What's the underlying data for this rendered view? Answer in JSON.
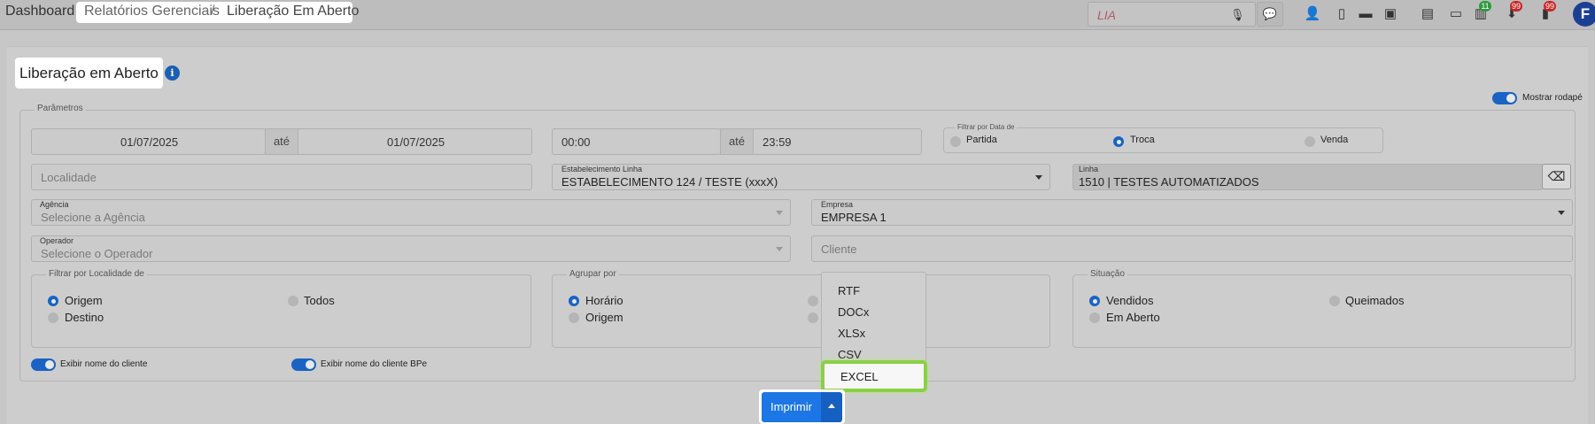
{
  "breadcrumb": {
    "home": "Dashboard",
    "level1": "Relatórios Gerenciais",
    "sep": "/",
    "current": "Liberação Em Aberto"
  },
  "topbar": {
    "search_placeholder": "LIA",
    "icons": [
      "user-key-icon",
      "mobile-icon",
      "ticket-icon",
      "save-icon",
      "newspaper-icon",
      "monitor-icon",
      "cash-icon",
      "download-icon",
      "document-icon"
    ],
    "badges": {
      "cash": "11",
      "download": "99",
      "document": "99"
    },
    "avatar": "F"
  },
  "page": {
    "title": "Liberação em Aberto",
    "footer_toggle_label": "Mostrar rodapé"
  },
  "params": {
    "legend": "Parâmetros",
    "date_start": "01/07/2025",
    "date_sep": "até",
    "date_end": "01/07/2025",
    "time_start": "00:00",
    "time_sep": "até",
    "time_end": "23:59",
    "filter_date": {
      "legend": "Filtrar por Data de",
      "options": [
        "Partida",
        "Troca",
        "Venda"
      ],
      "selected": "Troca"
    },
    "localidade_placeholder": "Localidade",
    "estabelecimento": {
      "label": "Estabelecimento Linha",
      "value": "ESTABELECIMENTO 124 / TESTE (xxxX)"
    },
    "linha": {
      "label": "Linha",
      "value": "1510 | TESTES AUTOMATIZADOS"
    },
    "agencia": {
      "label": "Agência",
      "placeholder": "Selecione a Agência"
    },
    "empresa": {
      "label": "Empresa",
      "value": "EMPRESA 1"
    },
    "operador": {
      "label": "Operador",
      "placeholder": "Selecione o Operador"
    },
    "cliente_placeholder": "Cliente",
    "filtro_localidade": {
      "legend": "Filtrar por Localidade de",
      "options": [
        "Origem",
        "Todos",
        "Destino"
      ],
      "selected": "Origem"
    },
    "agrupar": {
      "legend": "Agrupar por",
      "options": [
        "Horário",
        "Origem"
      ],
      "selected": "Horário"
    },
    "situacao": {
      "legend": "Situação",
      "options": [
        "Vendidos",
        "Queimados",
        "Em Aberto"
      ],
      "selected": "Vendidos"
    },
    "toggle_cliente": "Exibir nome do cliente",
    "toggle_cliente_bpe": "Exibir nome do cliente BPe"
  },
  "export_menu": {
    "items": [
      "RTF",
      "DOCx",
      "XLSx",
      "CSV",
      "EXCEL"
    ],
    "highlighted": "EXCEL"
  },
  "print_button": "Imprimir"
}
